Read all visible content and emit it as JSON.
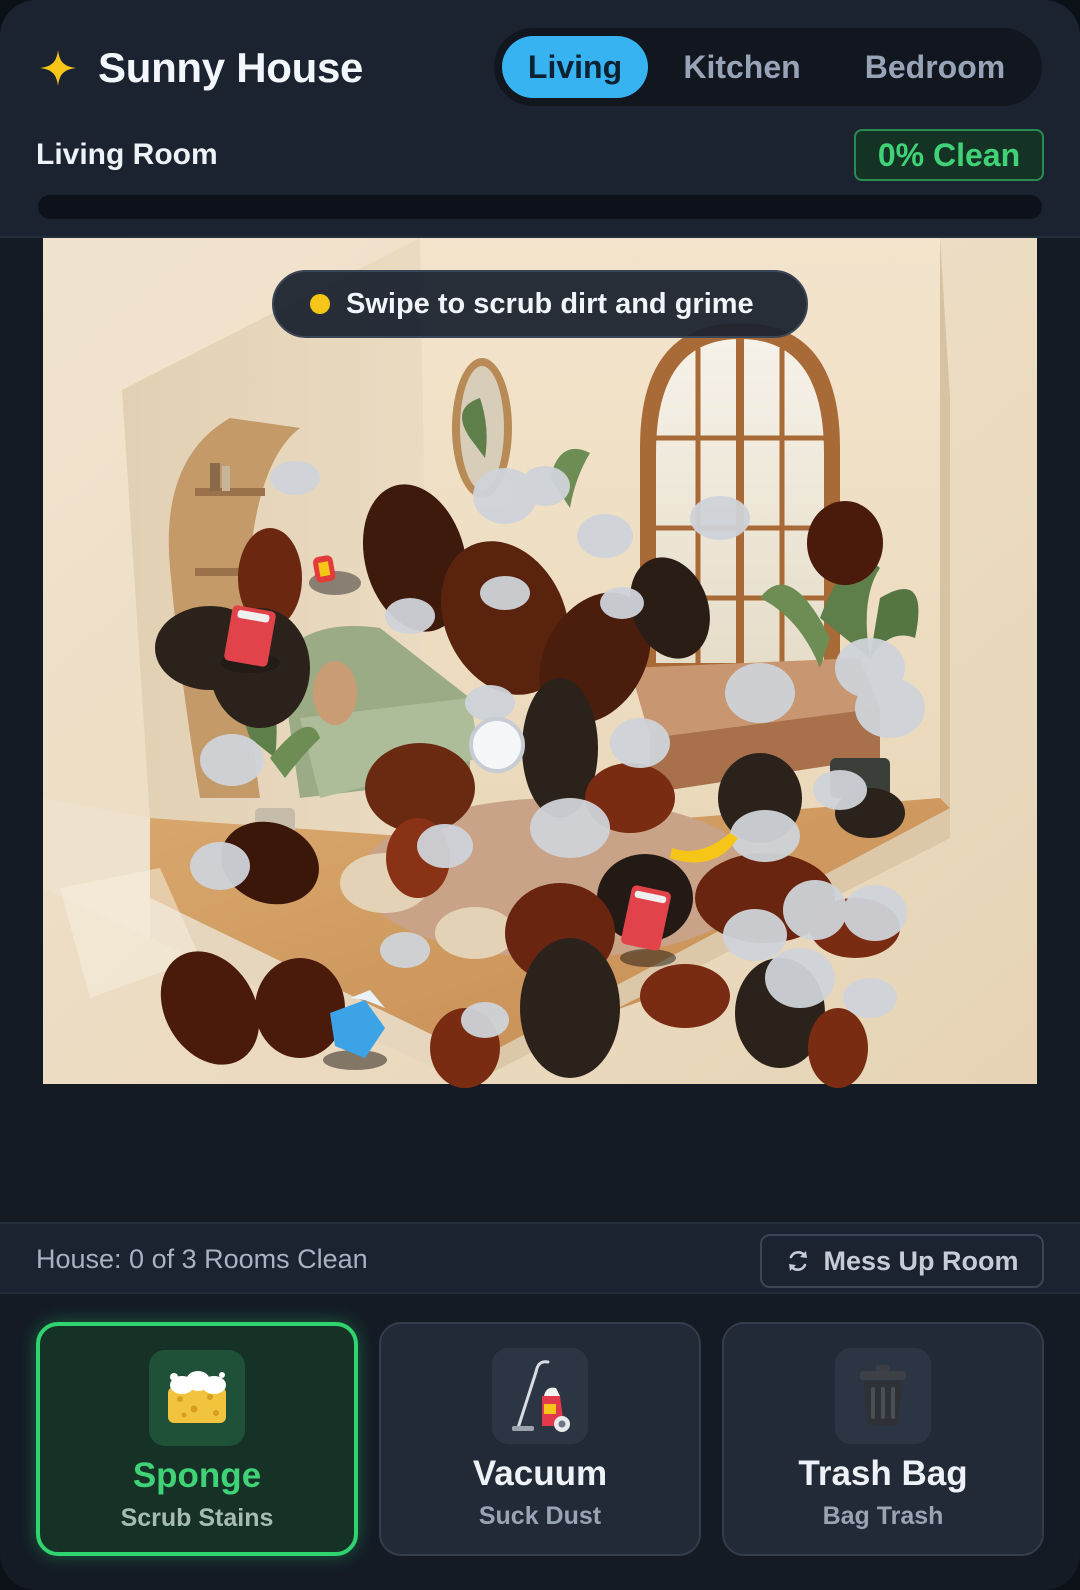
{
  "app": {
    "title": "Sunny House",
    "brand_icon": "sparkle-icon",
    "accent": "#36b3f0",
    "success": "#3fd277"
  },
  "tabs": [
    {
      "label": "Living",
      "active": true
    },
    {
      "label": "Kitchen",
      "active": false
    },
    {
      "label": "Bedroom",
      "active": false
    }
  ],
  "room": {
    "name": "Living Room",
    "clean_label": "0% Clean",
    "clean_fraction": 0
  },
  "scene": {
    "hint": "Swipe to scrub dirt and grime",
    "hint_icon": "yellow-dot-icon"
  },
  "status": {
    "house_text": "House: 0 of 3 Rooms Clean",
    "mess_button": "Mess Up Room",
    "mess_icon": "refresh-icon"
  },
  "tools": [
    {
      "name": "Sponge",
      "subtitle": "Scrub Stains",
      "icon": "sponge-icon",
      "selected": true
    },
    {
      "name": "Vacuum",
      "subtitle": "Suck Dust",
      "icon": "vacuum-icon",
      "selected": false
    },
    {
      "name": "Trash Bag",
      "subtitle": "Bag Trash",
      "icon": "trash-can-icon",
      "selected": false
    }
  ]
}
